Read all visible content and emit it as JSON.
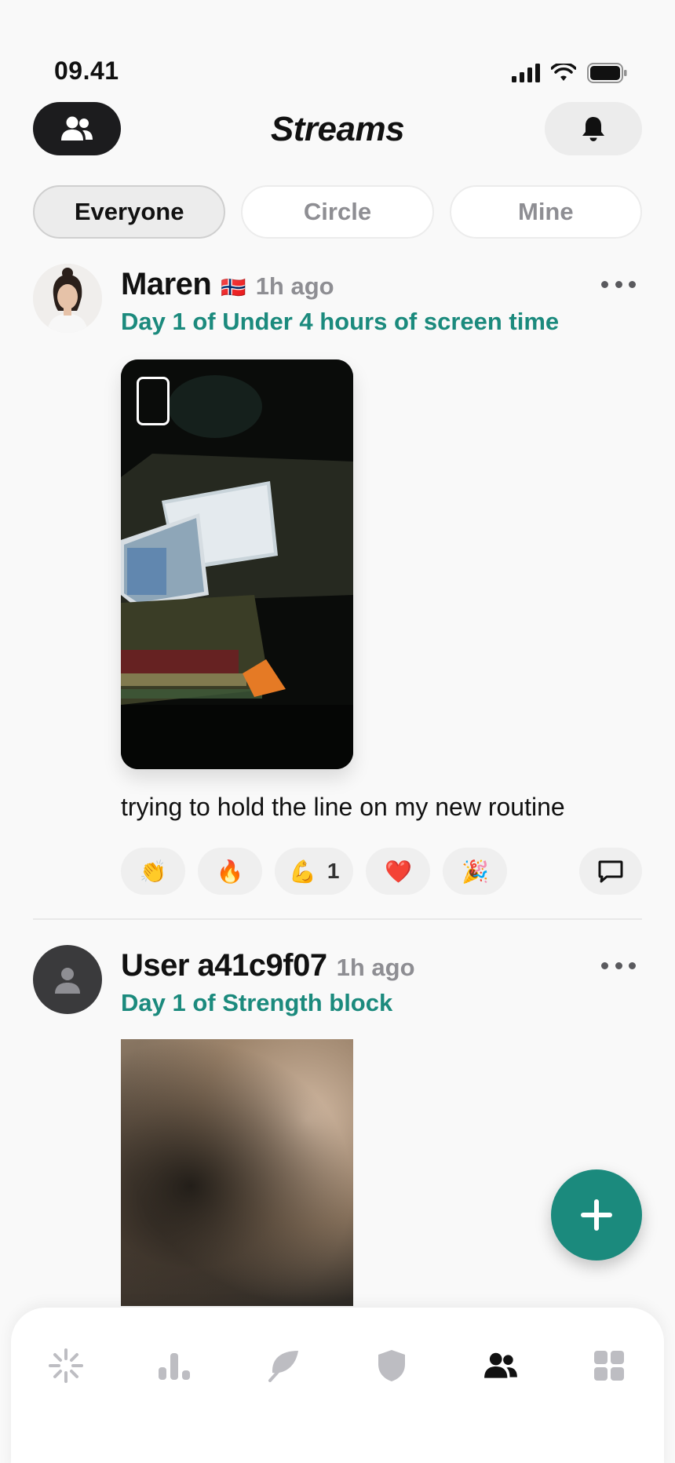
{
  "status": {
    "time": "09.41"
  },
  "header": {
    "title": "Streams"
  },
  "tabs": [
    {
      "label": "Everyone",
      "active": true
    },
    {
      "label": "Circle",
      "active": false
    },
    {
      "label": "Mine",
      "active": false
    }
  ],
  "posts": [
    {
      "name": "Maren",
      "flag": "🇳🇴",
      "time": "1h ago",
      "goal": "Day 1 of Under 4 hours of screen time",
      "caption": "trying to hold the line on my new routine",
      "reactions": [
        {
          "emoji": "👏",
          "count": ""
        },
        {
          "emoji": "🔥",
          "count": ""
        },
        {
          "emoji": "💪",
          "count": "1"
        },
        {
          "emoji": "❤️",
          "count": ""
        },
        {
          "emoji": "🎉",
          "count": ""
        }
      ]
    },
    {
      "name": "User a41c9f07",
      "time": "1h ago",
      "goal": "Day 1 of Strength block"
    }
  ],
  "colors": {
    "accent": "#1b8a7d",
    "dark": "#1c1c1e"
  },
  "tabbar": {
    "items": [
      {
        "icon": "sparkle-icon",
        "active": false
      },
      {
        "icon": "bar-chart-icon",
        "active": false
      },
      {
        "icon": "leaf-icon",
        "active": false
      },
      {
        "icon": "shield-icon",
        "active": false
      },
      {
        "icon": "people-icon",
        "active": true
      },
      {
        "icon": "grid-icon",
        "active": false
      }
    ]
  }
}
